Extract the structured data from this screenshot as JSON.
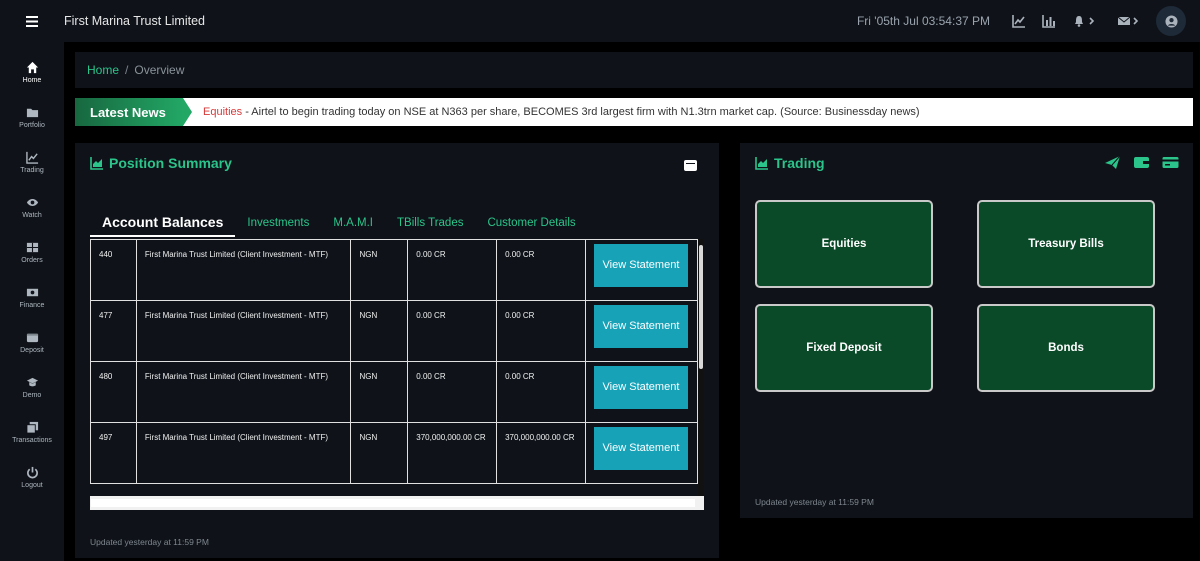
{
  "header": {
    "menu_icon": "hamburger-icon",
    "brand": "First Marina Trust Limited",
    "datetime": "Fri '05th Jul 03:54:37 PM",
    "icons": [
      "area-chart-icon",
      "bar-chart-icon",
      "bell-icon",
      "envelope-icon",
      "user-avatar-icon"
    ]
  },
  "sidebar": {
    "items": [
      {
        "label": "Home",
        "icon": "home-icon",
        "active": true
      },
      {
        "label": "Portfolio",
        "icon": "folder-icon"
      },
      {
        "label": "Trading",
        "icon": "line-chart-icon"
      },
      {
        "label": "Watch",
        "icon": "eye-icon"
      },
      {
        "label": "Orders",
        "icon": "grid-icon"
      },
      {
        "label": "Finance",
        "icon": "money-icon"
      },
      {
        "label": "Deposit",
        "icon": "wallet-icon"
      },
      {
        "label": "Demo",
        "icon": "graduation-cap-icon"
      },
      {
        "label": "Transactions",
        "icon": "copy-icon"
      },
      {
        "label": "Logout",
        "icon": "power-icon"
      }
    ]
  },
  "breadcrumb": {
    "home": "Home",
    "separator": "/",
    "current": "Overview"
  },
  "news": {
    "label": "Latest News",
    "category": "Equities",
    "text": " - Airtel to begin trading today on NSE at N363 per share, BECOMES 3rd largest firm with N1.3trn market cap. (Source: Businessday news)"
  },
  "position_summary": {
    "title": "Position Summary",
    "tabs": [
      "Account Balances",
      "Investments",
      "M.A.M.I",
      "TBills Trades",
      "Customer Details"
    ],
    "active_tab": 0,
    "rows": [
      {
        "id": "440",
        "name": "First Marina Trust Limited (Client Investment - MTF)",
        "currency": "NGN",
        "balance1": "0.00 CR",
        "balance2": "0.00 CR",
        "action": "View Statement"
      },
      {
        "id": "477",
        "name": "First Marina Trust Limited (Client Investment - MTF)",
        "currency": "NGN",
        "balance1": "0.00 CR",
        "balance2": "0.00 CR",
        "action": "View Statement"
      },
      {
        "id": "480",
        "name": "First Marina Trust Limited (Client Investment - MTF)",
        "currency": "NGN",
        "balance1": "0.00 CR",
        "balance2": "0.00 CR",
        "action": "View Statement"
      },
      {
        "id": "497",
        "name": "First Marina Trust Limited (Client Investment - MTF)",
        "currency": "NGN",
        "balance1": "370,000,000.00 CR",
        "balance2": "370,000,000.00 CR",
        "action": "View Statement"
      }
    ],
    "updated": "Updated yesterday at 11:59 PM"
  },
  "trading": {
    "title": "Trading",
    "icons": [
      "paper-plane-icon",
      "wallet-icon",
      "credit-card-icon"
    ],
    "buttons": [
      "Equities",
      "Treasury Bills",
      "Fixed Deposit",
      "Bonds"
    ],
    "updated": "Updated yesterday at 11:59 PM"
  },
  "colors": {
    "accent": "#2bc48a",
    "button": "#17a2b8",
    "trade_tile": "#0a4a28",
    "news_cat": "#d63a3a"
  }
}
